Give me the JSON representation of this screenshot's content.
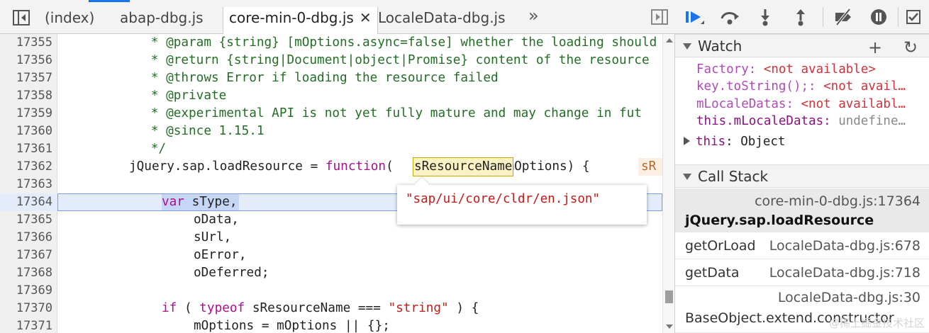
{
  "tabs": [
    {
      "label": "(index)"
    },
    {
      "label": "abap-dbg.js"
    },
    {
      "label": "core-min-0-dbg.js",
      "active": true
    },
    {
      "label": "LocaleData-dbg.js"
    }
  ],
  "tab_close_glyph": "✕",
  "tab_overflow_glyph": "»",
  "code_lines": [
    {
      "num": "17355",
      "text": "            * @param {string} [mOptions.async=false] whether the loading should"
    },
    {
      "num": "17356",
      "text": "            * @return {string|Document|object|Promise} content of the resource"
    },
    {
      "num": "17357",
      "text": "            * @throws Error if loading the resource failed"
    },
    {
      "num": "17358",
      "text": "            * @private"
    },
    {
      "num": "17359",
      "text": "            * @experimental API is not yet fully mature and may change in fut"
    },
    {
      "num": "17360",
      "text": "            * @since 1.15.1"
    },
    {
      "num": "17361",
      "text": "            */"
    },
    {
      "num": "17362",
      "text": "jQuery.sap.loadResource = function(sResourceName, mOptions) {"
    },
    {
      "num": "17363",
      "text": ""
    },
    {
      "num": "17364",
      "text": "var sType,"
    },
    {
      "num": "17365",
      "text": "oData,"
    },
    {
      "num": "17366",
      "text": "sUrl,"
    },
    {
      "num": "17367",
      "text": "oError,"
    },
    {
      "num": "17368",
      "text": "oDeferred;"
    },
    {
      "num": "17369",
      "text": ""
    },
    {
      "num": "17370",
      "text": "if ( typeof sResourceName === \"string\" ) {"
    },
    {
      "num": "17371",
      "text": "mOptions = mOptions || {};"
    }
  ],
  "inline_value_preview": "sR",
  "popover": {
    "value": "\"sap/ui/core/cldr/en.json\""
  },
  "watch": {
    "title": "Watch",
    "add_glyph": "+",
    "refresh_glyph": "↻",
    "items": [
      {
        "name": "Factory",
        "value": "<not available>"
      },
      {
        "name": "key.toString();",
        "value": "<not avail…"
      },
      {
        "name": "mLocaleDatas",
        "value": "<not availabl…"
      },
      {
        "name": "this.mLocaleDatas",
        "value": "undefine…"
      }
    ],
    "this_row": {
      "key": "this",
      "value": "Object"
    }
  },
  "call_stack": {
    "title": "Call Stack",
    "frames": [
      {
        "fn": "jQuery.sap.loadResource",
        "loc": "core-min-0-dbg.js:17364",
        "selected": true
      },
      {
        "fn": "getOrLoad",
        "loc": "LocaleData-dbg.js:678"
      },
      {
        "fn": "getData",
        "loc": "LocaleData-dbg.js:718"
      },
      {
        "fn": "BaseObject.extend.constructor",
        "loc": "LocaleData-dbg.js:30"
      }
    ]
  },
  "watermark": "@稀土掘金技术社区",
  "colors": {
    "comment": "#236e25",
    "keyword": "#aa0d91",
    "string": "#c41a16",
    "exec_line": "#e4ecfc",
    "accent": "#1a73e8"
  }
}
